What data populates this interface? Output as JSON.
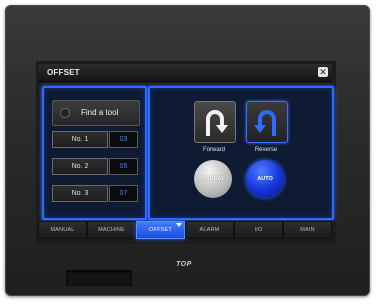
{
  "window": {
    "title": "OFFSET"
  },
  "left_panel": {
    "find_button_label": "Find a tool",
    "tools": [
      {
        "label": "No. 1",
        "value": "03"
      },
      {
        "label": "No. 2",
        "value": "05"
      },
      {
        "label": "No. 3",
        "value": "07"
      }
    ]
  },
  "right_panel": {
    "forward_label": "Forward",
    "reverse_label": "Reverse",
    "manual_label": "MANUAL",
    "auto_label": "AUTO"
  },
  "tabs": [
    {
      "label": "MANUAL"
    },
    {
      "label": "MACHINE"
    },
    {
      "label": "OFFSET"
    },
    {
      "label": "ALARM"
    },
    {
      "label": "I/O"
    },
    {
      "label": "MAIN"
    }
  ],
  "active_tab": "OFFSET",
  "brand": "TOP",
  "colors": {
    "accent": "#2f6bff",
    "value_text": "#3a86ff",
    "bezel": "#2b2b2b"
  },
  "icons": [
    "close-icon",
    "forward-arrow-icon",
    "reverse-arrow-icon",
    "tab-dropdown-icon"
  ]
}
